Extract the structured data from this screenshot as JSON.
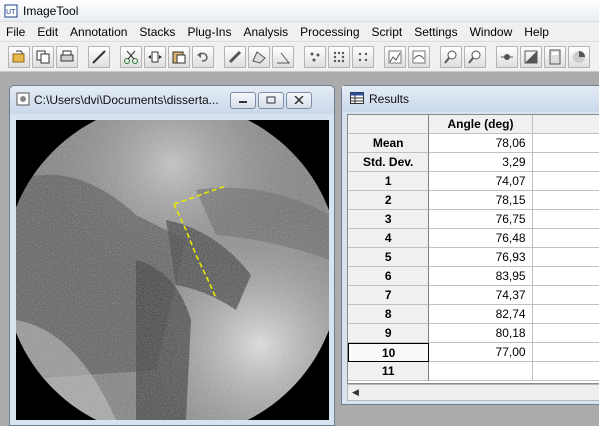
{
  "app": {
    "title": "ImageTool"
  },
  "menu": [
    "File",
    "Edit",
    "Annotation",
    "Stacks",
    "Plug-Ins",
    "Analysis",
    "Processing",
    "Script",
    "Settings",
    "Window",
    "Help"
  ],
  "image_window": {
    "title": "C:\\Users\\dvi\\Documents\\disserta..."
  },
  "results_window": {
    "title": "Results",
    "column_header": "Angle (deg)",
    "rows": [
      {
        "label": "Mean",
        "value": "78,06"
      },
      {
        "label": "Std. Dev.",
        "value": "3,29"
      },
      {
        "label": "1",
        "value": "74,07"
      },
      {
        "label": "2",
        "value": "78,15"
      },
      {
        "label": "3",
        "value": "76,75"
      },
      {
        "label": "4",
        "value": "76,48"
      },
      {
        "label": "5",
        "value": "76,93"
      },
      {
        "label": "6",
        "value": "83,95"
      },
      {
        "label": "7",
        "value": "74,37"
      },
      {
        "label": "8",
        "value": "82,74"
      },
      {
        "label": "9",
        "value": "80,18"
      },
      {
        "label": "10",
        "value": "77,00"
      },
      {
        "label": "11",
        "value": ""
      }
    ]
  }
}
